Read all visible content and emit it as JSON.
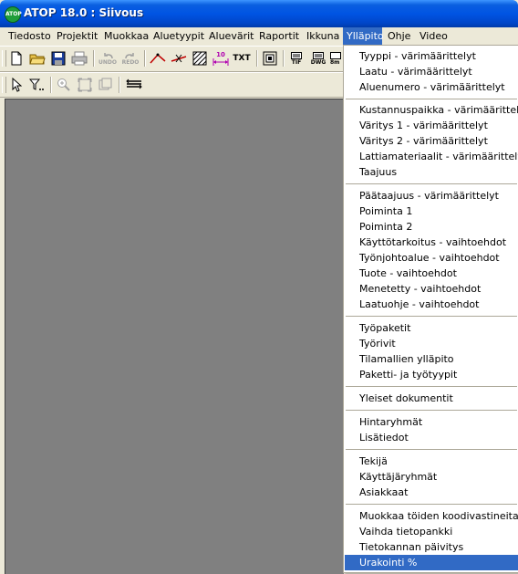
{
  "window": {
    "title": "ATOP 18.0 : Siivous",
    "logo_text": "ATOP"
  },
  "menubar": [
    {
      "label": "Tiedosto"
    },
    {
      "label": "Projektit"
    },
    {
      "label": "Muokkaa"
    },
    {
      "label": "Aluetyypit"
    },
    {
      "label": "Aluevärit"
    },
    {
      "label": "Raportit"
    },
    {
      "label": "Ikkuna"
    },
    {
      "label": "Ylläpito"
    },
    {
      "label": "Ohje"
    },
    {
      "label": "Video"
    }
  ],
  "toolbar": {
    "undo_label": "UNDO",
    "redo_label": "REDO",
    "txt_label": "TXT",
    "tif_label": "TIF",
    "dwg_label": "DWG",
    "dim_label": "10",
    "cut_label": "8m"
  },
  "dropdown": {
    "groups": [
      [
        "Tyyppi - värimäärittelyt",
        "Laatu - värimäärittelyt",
        "Aluenumero - värimäärittelyt"
      ],
      [
        "Kustannuspaikka - värimäärittelyt",
        "Väritys 1 - värimäärittelyt",
        "Väritys 2 - värimäärittelyt",
        "Lattiamateriaalit - värimäärittelyt",
        "Taajuus"
      ],
      [
        "Päätaajuus - värimäärittelyt",
        "Poiminta 1",
        "Poiminta 2",
        "Käyttötarkoitus - vaihtoehdot",
        "Työnjohtoalue - vaihtoehdot",
        "Tuote - vaihtoehdot",
        "Menetetty - vaihtoehdot",
        "Laatuohje - vaihtoehdot"
      ],
      [
        "Työpaketit",
        "Työrivit",
        "Tilamallien ylläpito",
        "Paketti- ja työtyypit"
      ],
      [
        "Yleiset dokumentit"
      ],
      [
        "Hintaryhmät",
        "Lisätiedot"
      ],
      [
        "Tekijä",
        "Käyttäjäryhmät",
        "Asiakkaat"
      ],
      [
        "Muokkaa töiden koodivastineita",
        "Vaihda tietopankki",
        "Tietokannan päivitys",
        "Urakointi %"
      ]
    ]
  },
  "colors": {
    "highlight": "#316ac5",
    "workspace": "#808080",
    "titlebar": "#0054e3"
  }
}
